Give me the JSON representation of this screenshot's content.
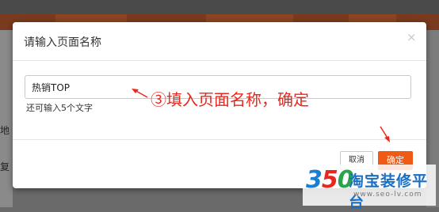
{
  "background": {
    "left_chars": [
      "地",
      "复"
    ]
  },
  "dialog": {
    "title": "请输入页面名称",
    "close_glyph": "×",
    "input_value": "热销TOP",
    "hint": "还可输入5个文字",
    "cancel_label": "取消",
    "confirm_label": "确定"
  },
  "annotation": {
    "text": "③填入页面名称，确定"
  },
  "watermark": {
    "digits": [
      "3",
      "5",
      "0"
    ],
    "name": "淘宝装修平台",
    "url": "www.seo-lv.com"
  },
  "colors": {
    "accent": "#ef5a17",
    "annotation": "#e8281e",
    "logo_blue": "#1b6fc2"
  }
}
